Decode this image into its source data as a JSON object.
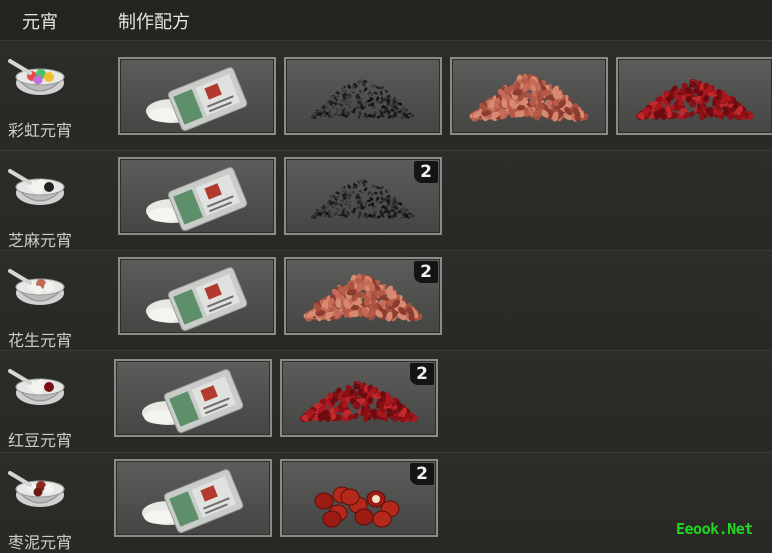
{
  "header": {
    "name_col": "元宵",
    "recipe_col": "制作配方"
  },
  "recipes": [
    {
      "name": "彩虹元宵",
      "icon": "rainbow-yuanxiao-bowl-icon",
      "ingredients": [
        {
          "icon": "glutinous-rice-flour-bag-icon",
          "qty": ""
        },
        {
          "icon": "black-sesame-pile-icon",
          "qty": ""
        },
        {
          "icon": "peanut-pile-icon",
          "qty": ""
        },
        {
          "icon": "red-bean-pile-icon",
          "qty": ""
        }
      ]
    },
    {
      "name": "芝麻元宵",
      "icon": "sesame-yuanxiao-bowl-icon",
      "ingredients": [
        {
          "icon": "glutinous-rice-flour-bag-icon",
          "qty": ""
        },
        {
          "icon": "black-sesame-pile-icon",
          "qty": "2"
        }
      ]
    },
    {
      "name": "花生元宵",
      "icon": "peanut-yuanxiao-bowl-icon",
      "ingredients": [
        {
          "icon": "glutinous-rice-flour-bag-icon",
          "qty": ""
        },
        {
          "icon": "peanut-pile-icon",
          "qty": "2"
        }
      ]
    },
    {
      "name": "红豆元宵",
      "icon": "red-bean-yuanxiao-bowl-icon",
      "ingredients": [
        {
          "icon": "glutinous-rice-flour-bag-icon",
          "qty": ""
        },
        {
          "icon": "red-bean-pile-icon",
          "qty": "2"
        }
      ]
    },
    {
      "name": "枣泥元宵",
      "icon": "jujube-yuanxiao-bowl-icon",
      "ingredients": [
        {
          "icon": "glutinous-rice-flour-bag-icon",
          "qty": ""
        },
        {
          "icon": "red-dates-icon",
          "qty": "2"
        }
      ]
    }
  ],
  "watermark": "Eeook.Net",
  "colors": {
    "watermark": "#1fd81f",
    "slot_border": "#8a8a86",
    "background": "#2a2a27"
  }
}
